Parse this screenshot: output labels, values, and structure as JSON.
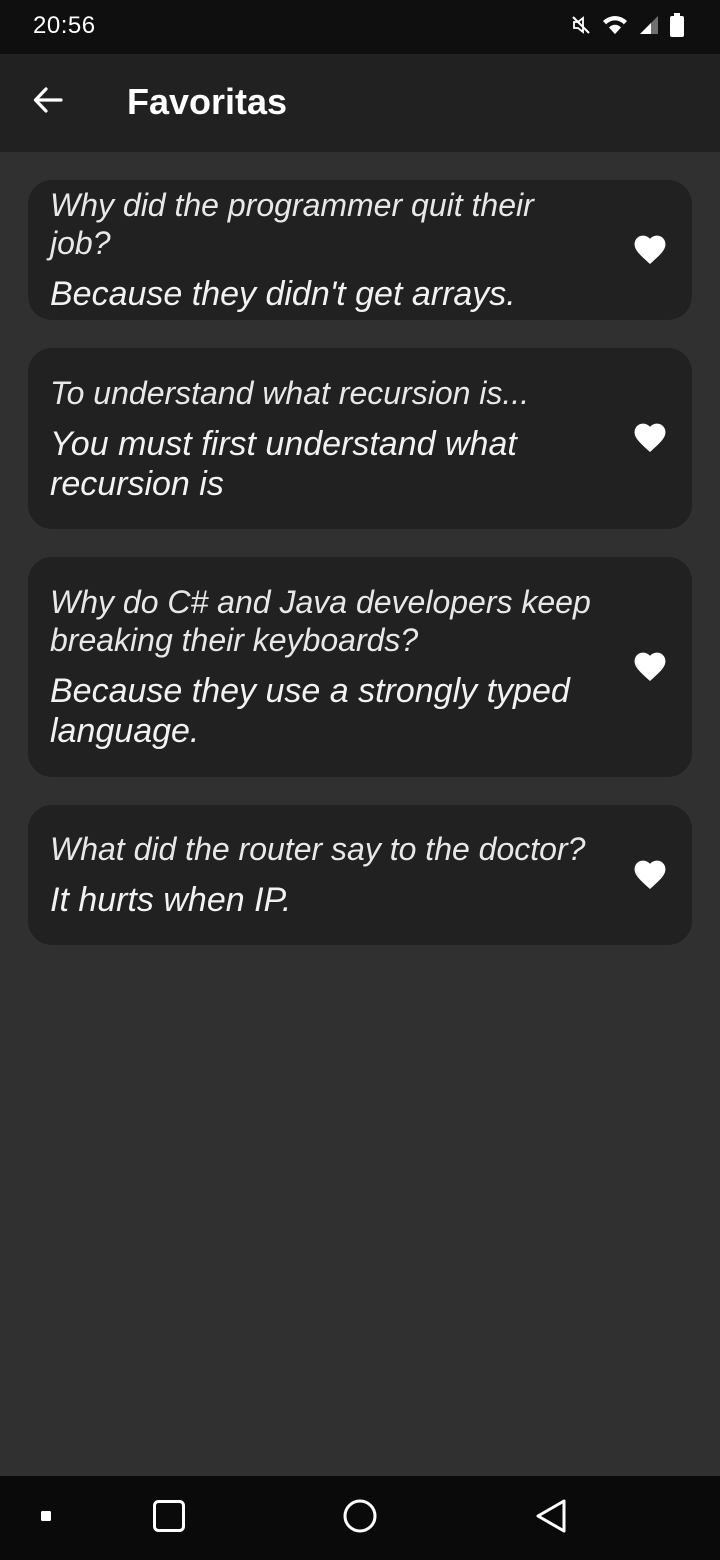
{
  "status_bar": {
    "time": "20:56",
    "icons": [
      "mute-icon",
      "wifi-icon",
      "signal-icon",
      "battery-icon"
    ]
  },
  "app_bar": {
    "title": "Favoritas",
    "back_icon": "arrow-back-icon"
  },
  "jokes": [
    {
      "question": "Why did the programmer quit their job?",
      "answer": "Because they didn't get arrays.",
      "favorite": true
    },
    {
      "question": "To understand what recursion is...",
      "answer": "You must first understand what recursion is",
      "favorite": true
    },
    {
      "question": "Why do C# and Java developers keep breaking their keyboards?",
      "answer": "Because they use a strongly typed language.",
      "favorite": true
    },
    {
      "question": "What did the router say to the doctor?",
      "answer": "It hurts when IP.",
      "favorite": true
    }
  ],
  "nav_bar": {
    "icons": [
      "overflow-icon",
      "recents-icon",
      "home-icon",
      "back-icon"
    ]
  },
  "colors": {
    "background": "#303030",
    "app_bar": "#212121",
    "card": "#212121",
    "status_bar": "#0f0f0f",
    "nav_bar": "#0a0a0a",
    "heart": "#ffffff"
  }
}
